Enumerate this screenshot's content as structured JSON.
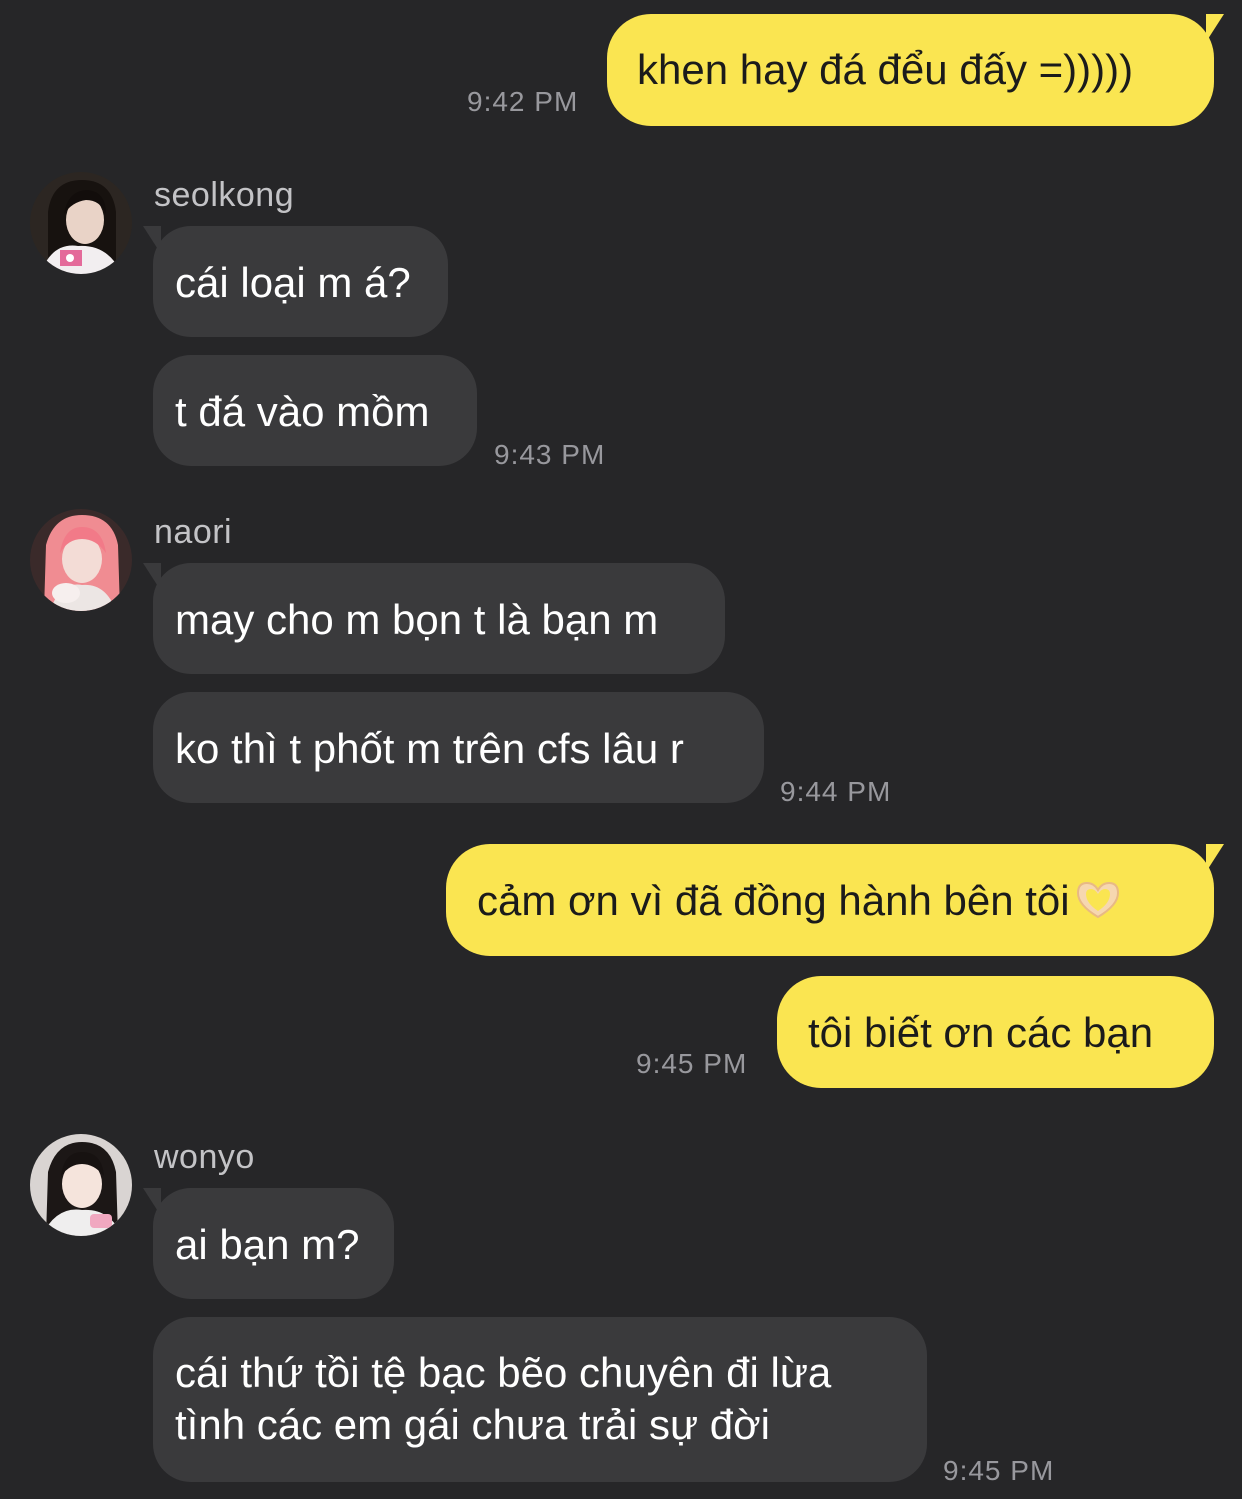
{
  "messages": {
    "m1": {
      "text": "khen hay đá đểu đấy =)))))",
      "time": "9:42 PM"
    },
    "seolkong": {
      "name": "seolkong",
      "m1": "cái loại m á?",
      "m2": "t đá vào mồm",
      "time": "9:43 PM"
    },
    "naori": {
      "name": "naori",
      "m1": "may cho m bọn t là bạn m",
      "m2": "ko thì t phốt m trên cfs lâu r",
      "time": "9:44 PM"
    },
    "me2": {
      "m1": "cảm ơn vì đã đồng hành bên tôi",
      "m1_emoji": "heart-hands-icon",
      "m2": "tôi biết ơn các bạn",
      "time": "9:45 PM"
    },
    "wonyo": {
      "name": "wonyo",
      "m1": "ai bạn m?",
      "m2": "cái thứ tồi tệ bạc bẽo chuyên đi lừa tình các em gái chưa trải sự đời",
      "time": "9:45 PM"
    }
  },
  "colors": {
    "background": "#262628",
    "outgoing_bubble": "#fae551",
    "incoming_bubble": "#3a3a3c",
    "timestamp": "#98989d"
  }
}
